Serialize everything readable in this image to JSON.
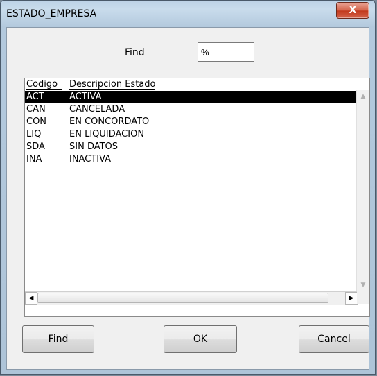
{
  "window": {
    "title": "ESTADO_EMPRESA",
    "close_label": "X"
  },
  "search": {
    "label": "Find",
    "value": "%"
  },
  "list": {
    "columns": [
      "Codigo",
      "Descripcion Estado"
    ],
    "rows": [
      {
        "code": "ACT",
        "desc": "ACTIVA",
        "selected": true
      },
      {
        "code": "CAN",
        "desc": "CANCELADA",
        "selected": false
      },
      {
        "code": "CON",
        "desc": "EN CONCORDATO",
        "selected": false
      },
      {
        "code": "LIQ",
        "desc": "EN LIQUIDACION",
        "selected": false
      },
      {
        "code": "SDA",
        "desc": "SIN DATOS",
        "selected": false
      },
      {
        "code": "INA",
        "desc": "INACTIVA",
        "selected": false
      }
    ]
  },
  "buttons": {
    "find": "Find",
    "ok": "OK",
    "cancel": "Cancel"
  },
  "icons": {
    "scroll_up": "triangle-up",
    "scroll_down": "triangle-down",
    "scroll_left": "triangle-left",
    "scroll_right": "triangle-right"
  }
}
